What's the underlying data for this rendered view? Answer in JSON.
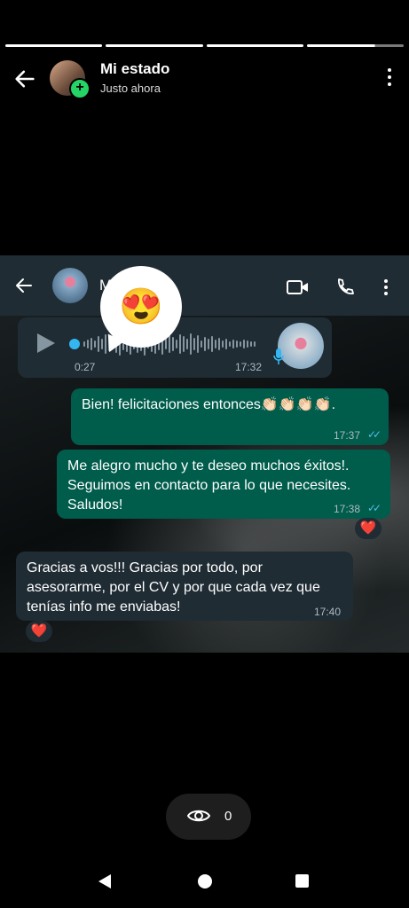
{
  "status": {
    "title": "Mi estado",
    "subtitle": "Justo ahora",
    "progress_segments": 4
  },
  "chat": {
    "header_name": "M",
    "reaction_emoji": "😍",
    "voice_message": {
      "duration": "0:27",
      "time": "17:32"
    },
    "messages": [
      {
        "direction": "outgoing",
        "text": "Bien! felicitaciones entonces👏🏻👏🏻👏🏻👏🏻.",
        "time": "17:37",
        "ticks": "✓✓"
      },
      {
        "direction": "outgoing",
        "text": "Me alegro mucho y te deseo muchos éxitos!. Seguimos en contacto para lo que necesites. Saludos!",
        "time": "17:38",
        "ticks": "✓✓",
        "reaction": "❤️"
      },
      {
        "direction": "incoming",
        "text": "Gracias a vos!!! Gracias por todo, por asesorarme, por el CV y por que cada vez que tenías info me enviabas!",
        "time": "17:40",
        "reaction": "❤️"
      }
    ]
  },
  "viewers": {
    "count": "0"
  },
  "colors": {
    "outgoing_bubble": "#005c4b",
    "incoming_bubble": "#1f2c34",
    "accent": "#25d366",
    "read_ticks": "#53bdeb"
  },
  "icons": [
    "back-arrow-icon",
    "add-status-icon",
    "menu-dots-icon",
    "video-call-icon",
    "phone-icon",
    "play-icon",
    "mic-icon",
    "eye-icon",
    "nav-back-icon",
    "nav-home-icon",
    "nav-recents-icon"
  ]
}
